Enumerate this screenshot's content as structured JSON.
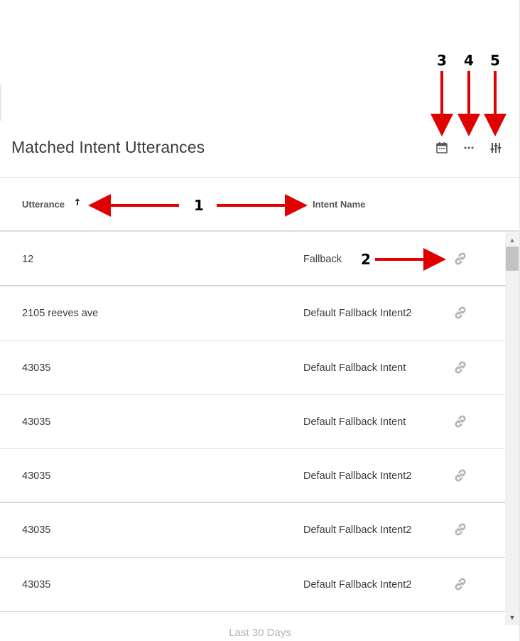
{
  "card": {
    "title": "Matched Intent Utterances",
    "footer": "Last 30 Days"
  },
  "toolbar": {
    "calendar_icon": "calendar-icon",
    "more_icon": "more-horizontal-icon",
    "settings_icon": "sliders-icon"
  },
  "table": {
    "columns": [
      "Utterance",
      "Intent Name"
    ],
    "sort_indicator": "🠑",
    "rows": [
      {
        "utterance": "12",
        "intent": "Fallback"
      },
      {
        "utterance": "2105 reeves ave",
        "intent": "Default Fallback Intent2"
      },
      {
        "utterance": "43035",
        "intent": "Default Fallback Intent"
      },
      {
        "utterance": "43035",
        "intent": "Default Fallback Intent"
      },
      {
        "utterance": "43035",
        "intent": "Default Fallback Intent2"
      },
      {
        "utterance": "43035",
        "intent": "Default Fallback Intent2"
      },
      {
        "utterance": "43035",
        "intent": "Default Fallback Intent2"
      }
    ]
  },
  "annotations": [
    "1",
    "2",
    "3",
    "4",
    "5"
  ],
  "colors": {
    "annotation_arrow": "#e00000",
    "link_icon": "#b3b3b3",
    "header_text": "#555555"
  }
}
